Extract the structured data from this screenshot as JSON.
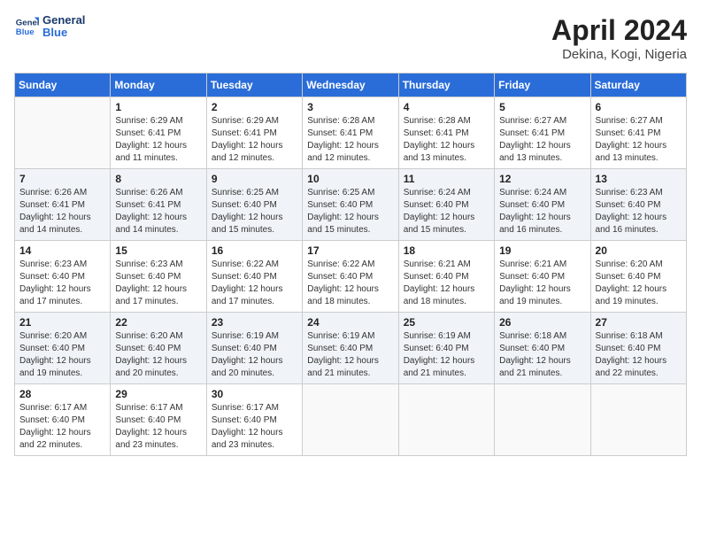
{
  "header": {
    "logo_line1": "General",
    "logo_line2": "Blue",
    "month_year": "April 2024",
    "location": "Dekina, Kogi, Nigeria"
  },
  "weekdays": [
    "Sunday",
    "Monday",
    "Tuesday",
    "Wednesday",
    "Thursday",
    "Friday",
    "Saturday"
  ],
  "weeks": [
    [
      {
        "day": "",
        "info": ""
      },
      {
        "day": "1",
        "info": "Sunrise: 6:29 AM\nSunset: 6:41 PM\nDaylight: 12 hours\nand 11 minutes."
      },
      {
        "day": "2",
        "info": "Sunrise: 6:29 AM\nSunset: 6:41 PM\nDaylight: 12 hours\nand 12 minutes."
      },
      {
        "day": "3",
        "info": "Sunrise: 6:28 AM\nSunset: 6:41 PM\nDaylight: 12 hours\nand 12 minutes."
      },
      {
        "day": "4",
        "info": "Sunrise: 6:28 AM\nSunset: 6:41 PM\nDaylight: 12 hours\nand 13 minutes."
      },
      {
        "day": "5",
        "info": "Sunrise: 6:27 AM\nSunset: 6:41 PM\nDaylight: 12 hours\nand 13 minutes."
      },
      {
        "day": "6",
        "info": "Sunrise: 6:27 AM\nSunset: 6:41 PM\nDaylight: 12 hours\nand 13 minutes."
      }
    ],
    [
      {
        "day": "7",
        "info": "Sunrise: 6:26 AM\nSunset: 6:41 PM\nDaylight: 12 hours\nand 14 minutes."
      },
      {
        "day": "8",
        "info": "Sunrise: 6:26 AM\nSunset: 6:41 PM\nDaylight: 12 hours\nand 14 minutes."
      },
      {
        "day": "9",
        "info": "Sunrise: 6:25 AM\nSunset: 6:40 PM\nDaylight: 12 hours\nand 15 minutes."
      },
      {
        "day": "10",
        "info": "Sunrise: 6:25 AM\nSunset: 6:40 PM\nDaylight: 12 hours\nand 15 minutes."
      },
      {
        "day": "11",
        "info": "Sunrise: 6:24 AM\nSunset: 6:40 PM\nDaylight: 12 hours\nand 15 minutes."
      },
      {
        "day": "12",
        "info": "Sunrise: 6:24 AM\nSunset: 6:40 PM\nDaylight: 12 hours\nand 16 minutes."
      },
      {
        "day": "13",
        "info": "Sunrise: 6:23 AM\nSunset: 6:40 PM\nDaylight: 12 hours\nand 16 minutes."
      }
    ],
    [
      {
        "day": "14",
        "info": "Sunrise: 6:23 AM\nSunset: 6:40 PM\nDaylight: 12 hours\nand 17 minutes."
      },
      {
        "day": "15",
        "info": "Sunrise: 6:23 AM\nSunset: 6:40 PM\nDaylight: 12 hours\nand 17 minutes."
      },
      {
        "day": "16",
        "info": "Sunrise: 6:22 AM\nSunset: 6:40 PM\nDaylight: 12 hours\nand 17 minutes."
      },
      {
        "day": "17",
        "info": "Sunrise: 6:22 AM\nSunset: 6:40 PM\nDaylight: 12 hours\nand 18 minutes."
      },
      {
        "day": "18",
        "info": "Sunrise: 6:21 AM\nSunset: 6:40 PM\nDaylight: 12 hours\nand 18 minutes."
      },
      {
        "day": "19",
        "info": "Sunrise: 6:21 AM\nSunset: 6:40 PM\nDaylight: 12 hours\nand 19 minutes."
      },
      {
        "day": "20",
        "info": "Sunrise: 6:20 AM\nSunset: 6:40 PM\nDaylight: 12 hours\nand 19 minutes."
      }
    ],
    [
      {
        "day": "21",
        "info": "Sunrise: 6:20 AM\nSunset: 6:40 PM\nDaylight: 12 hours\nand 19 minutes."
      },
      {
        "day": "22",
        "info": "Sunrise: 6:20 AM\nSunset: 6:40 PM\nDaylight: 12 hours\nand 20 minutes."
      },
      {
        "day": "23",
        "info": "Sunrise: 6:19 AM\nSunset: 6:40 PM\nDaylight: 12 hours\nand 20 minutes."
      },
      {
        "day": "24",
        "info": "Sunrise: 6:19 AM\nSunset: 6:40 PM\nDaylight: 12 hours\nand 21 minutes."
      },
      {
        "day": "25",
        "info": "Sunrise: 6:19 AM\nSunset: 6:40 PM\nDaylight: 12 hours\nand 21 minutes."
      },
      {
        "day": "26",
        "info": "Sunrise: 6:18 AM\nSunset: 6:40 PM\nDaylight: 12 hours\nand 21 minutes."
      },
      {
        "day": "27",
        "info": "Sunrise: 6:18 AM\nSunset: 6:40 PM\nDaylight: 12 hours\nand 22 minutes."
      }
    ],
    [
      {
        "day": "28",
        "info": "Sunrise: 6:17 AM\nSunset: 6:40 PM\nDaylight: 12 hours\nand 22 minutes."
      },
      {
        "day": "29",
        "info": "Sunrise: 6:17 AM\nSunset: 6:40 PM\nDaylight: 12 hours\nand 23 minutes."
      },
      {
        "day": "30",
        "info": "Sunrise: 6:17 AM\nSunset: 6:40 PM\nDaylight: 12 hours\nand 23 minutes."
      },
      {
        "day": "",
        "info": ""
      },
      {
        "day": "",
        "info": ""
      },
      {
        "day": "",
        "info": ""
      },
      {
        "day": "",
        "info": ""
      }
    ]
  ]
}
